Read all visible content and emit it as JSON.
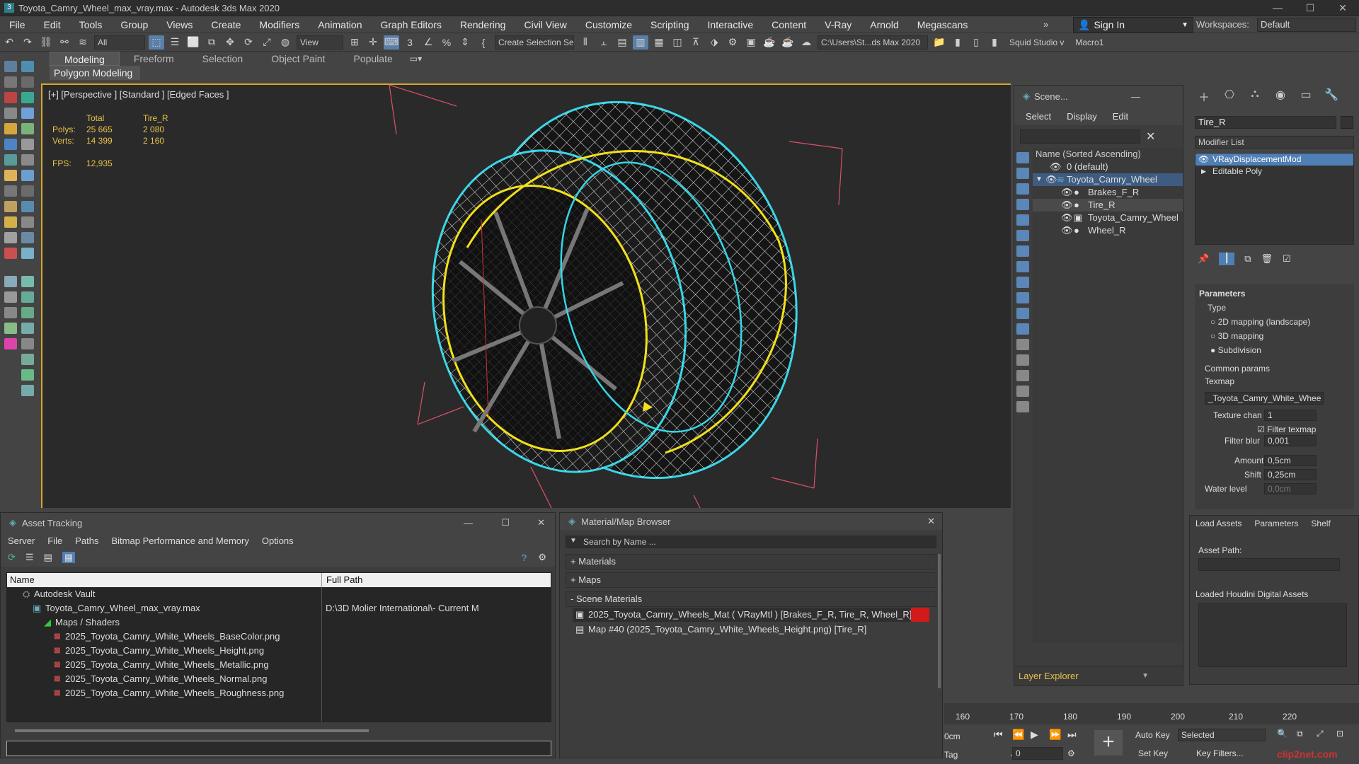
{
  "window": {
    "title": "Toyota_Camry_Wheel_max_vray.max - Autodesk 3ds Max 2020",
    "min": "—",
    "max": "☐",
    "close": "✕"
  },
  "menubar": {
    "items": [
      "File",
      "Edit",
      "Tools",
      "Group",
      "Views",
      "Create",
      "Modifiers",
      "Animation",
      "Graph Editors",
      "Rendering",
      "Civil View",
      "Customize",
      "Scripting",
      "Interactive",
      "Content",
      "V-Ray",
      "Arnold",
      "Megascans"
    ],
    "signin": "Sign In",
    "workspaces_label": "Workspaces:",
    "workspace_value": "Default"
  },
  "toolbar": {
    "filter": "All",
    "view": "View",
    "selection_set": "Create Selection Se",
    "path": "C:\\Users\\St...ds Max 2020",
    "squid": "Squid Studio v",
    "macro": "Macro1"
  },
  "ribbon": {
    "tabs": [
      "Modeling",
      "Freeform",
      "Selection",
      "Object Paint",
      "Populate"
    ],
    "sub": "Polygon Modeling"
  },
  "viewport": {
    "label": "[+] [Perspective ] [Standard ] [Edged Faces ]",
    "stats": {
      "col_total": "Total",
      "col_obj": "Tire_R",
      "polys_label": "Polys:",
      "polys_total": "25 665",
      "polys_obj": "2 080",
      "verts_label": "Verts:",
      "verts_total": "14 399",
      "verts_obj": "2 160",
      "fps_label": "FPS:",
      "fps_value": "12,935"
    }
  },
  "scene_explorer": {
    "title": "Scene...",
    "menu": [
      "Select",
      "Display",
      "Edit"
    ],
    "column": "Name (Sorted Ascending)",
    "rows": [
      "0 (default)",
      "Toyota_Camry_Wheel",
      "Brakes_F_R",
      "Tire_R",
      "Toyota_Camry_Wheel",
      "Wheel_R"
    ],
    "footer": "Layer Explorer"
  },
  "command_panel": {
    "object_name": "Tire_R",
    "modifier_list": "Modifier List",
    "stack": [
      "VRayDisplacementMod",
      "Editable Poly"
    ],
    "params": {
      "header": "Parameters",
      "type_label": "Type",
      "types": [
        "2D mapping (landscape)",
        "3D mapping",
        "Subdivision"
      ],
      "common": "Common params",
      "texmap_label": "Texmap",
      "texmap_value": "_Toyota_Camry_White_Whee",
      "texture_chan_label": "Texture chan",
      "texture_chan_value": "1",
      "filter_texmap": "Filter texmap",
      "filter_blur_label": "Filter blur",
      "filter_blur_value": "0,001",
      "amount_label": "Amount",
      "amount_value": "0,5cm",
      "shift_label": "Shift",
      "shift_value": "0,25cm",
      "water_label": "Water level",
      "water_value": "0,0cm"
    }
  },
  "houdini": {
    "tabs": [
      "Load Assets",
      "Parameters",
      "Shelf"
    ],
    "asset_path": "Asset Path:",
    "loaded": "Loaded Houdini Digital Assets"
  },
  "asset_tracking": {
    "title": "Asset Tracking",
    "menu": [
      "Server",
      "File",
      "Paths",
      "Bitmap Performance and Memory",
      "Options"
    ],
    "col_name": "Name",
    "col_path": "Full Path",
    "rows": [
      {
        "name": "Autodesk Vault",
        "path": ""
      },
      {
        "name": "Toyota_Camry_Wheel_max_vray.max",
        "path": "D:\\3D Molier International\\- Current M"
      },
      {
        "name": "Maps / Shaders",
        "path": ""
      },
      {
        "name": "2025_Toyota_Camry_White_Wheels_BaseColor.png",
        "path": ""
      },
      {
        "name": "2025_Toyota_Camry_White_Wheels_Height.png",
        "path": ""
      },
      {
        "name": "2025_Toyota_Camry_White_Wheels_Metallic.png",
        "path": ""
      },
      {
        "name": "2025_Toyota_Camry_White_Wheels_Normal.png",
        "path": ""
      },
      {
        "name": "2025_Toyota_Camry_White_Wheels_Roughness.png",
        "path": ""
      }
    ]
  },
  "material_browser": {
    "title": "Material/Map Browser",
    "search_placeholder": "Search by Name ...",
    "groups": [
      "+ Materials",
      "+ Maps",
      "- Scene Materials"
    ],
    "items": [
      "2025_Toyota_Camry_Wheels_Mat  ( VRayMtl ) [Brakes_F_R, Tire_R, Wheel_R]",
      "Map #40 (2025_Toyota_Camry_White_Wheels_Height.png) [Tire_R]"
    ]
  },
  "timeline": {
    "ticks": [
      "160",
      "170",
      "180",
      "190",
      "200",
      "210",
      "220"
    ]
  },
  "anim": {
    "autokey": "Auto Key",
    "setkey": "Set Key",
    "selected": "Selected",
    "keyfilters": "Key Filters...",
    "frame": "0",
    "cm": "0cm",
    "tag": "Tag"
  },
  "watermark": "clip2net.com",
  "colors": {
    "accent": "#5b86b8",
    "selection": "#3e5c82",
    "viewport_border": "#d6a829",
    "stats": "#e7c24a",
    "wire_cyan": "#35d6e6",
    "wire_yellow": "#f2e01a"
  }
}
